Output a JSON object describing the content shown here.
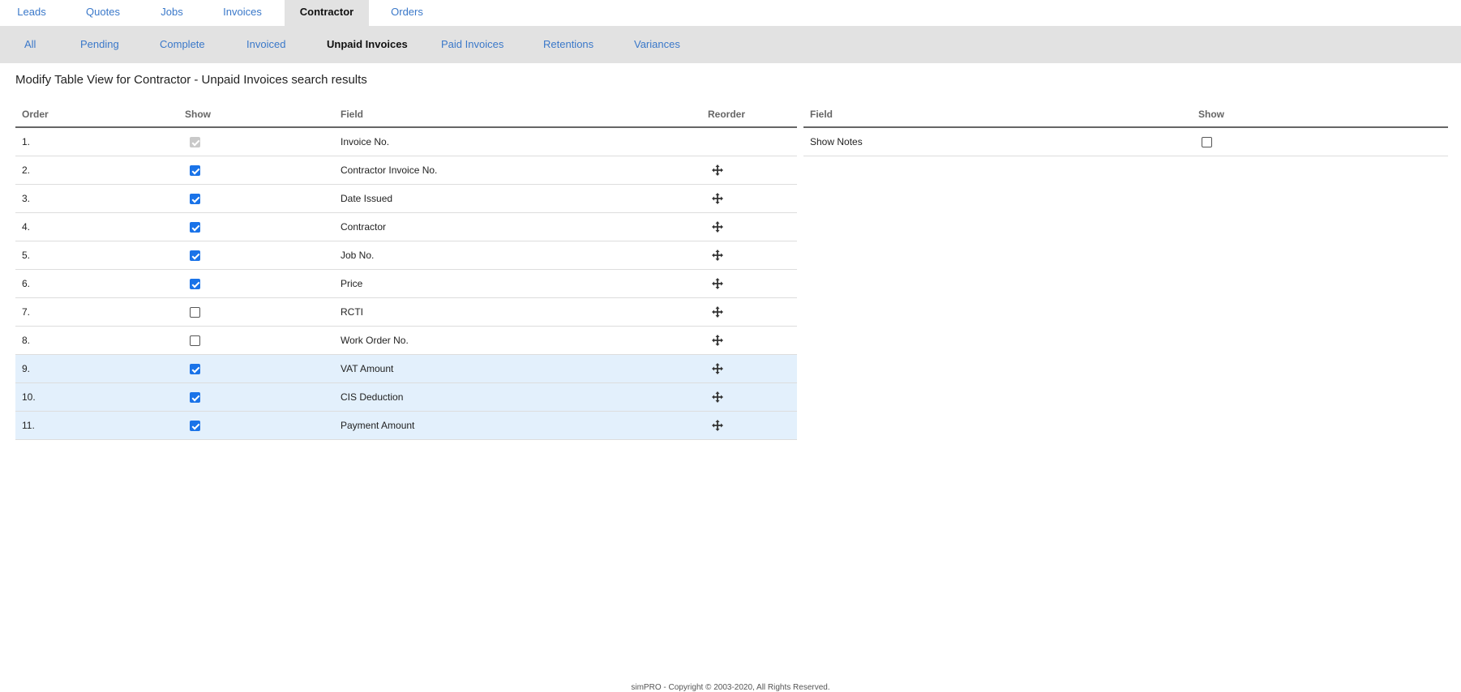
{
  "top_tabs": [
    {
      "label": "Leads",
      "active": false
    },
    {
      "label": "Quotes",
      "active": false
    },
    {
      "label": "Jobs",
      "active": false
    },
    {
      "label": "Invoices",
      "active": false
    },
    {
      "label": "Contractor",
      "active": true
    },
    {
      "label": "Orders",
      "active": false
    }
  ],
  "sub_tabs": [
    {
      "label": "All",
      "active": false
    },
    {
      "label": "Pending",
      "active": false
    },
    {
      "label": "Complete",
      "active": false
    },
    {
      "label": "Invoiced",
      "active": false
    },
    {
      "label": "Unpaid Invoices",
      "active": true
    },
    {
      "label": "Paid Invoices",
      "active": false
    },
    {
      "label": "Retentions",
      "active": false
    },
    {
      "label": "Variances",
      "active": false
    }
  ],
  "page_title": "Modify Table View for Contractor - Unpaid Invoices search results",
  "main_table": {
    "headers": {
      "order": "Order",
      "show": "Show",
      "field": "Field",
      "reorder": "Reorder"
    },
    "rows": [
      {
        "order": "1.",
        "show": "disabled-checked",
        "field": "Invoice No.",
        "reorder": false,
        "highlight": false
      },
      {
        "order": "2.",
        "show": "checked",
        "field": "Contractor Invoice No.",
        "reorder": true,
        "highlight": false
      },
      {
        "order": "3.",
        "show": "checked",
        "field": "Date Issued",
        "reorder": true,
        "highlight": false
      },
      {
        "order": "4.",
        "show": "checked",
        "field": "Contractor",
        "reorder": true,
        "highlight": false
      },
      {
        "order": "5.",
        "show": "checked",
        "field": "Job No.",
        "reorder": true,
        "highlight": false
      },
      {
        "order": "6.",
        "show": "checked",
        "field": "Price",
        "reorder": true,
        "highlight": false
      },
      {
        "order": "7.",
        "show": "unchecked",
        "field": "RCTI",
        "reorder": true,
        "highlight": false
      },
      {
        "order": "8.",
        "show": "unchecked",
        "field": "Work Order No.",
        "reorder": true,
        "highlight": false
      },
      {
        "order": "9.",
        "show": "checked",
        "field": "VAT Amount",
        "reorder": true,
        "highlight": true
      },
      {
        "order": "10.",
        "show": "checked",
        "field": "CIS Deduction",
        "reorder": true,
        "highlight": true
      },
      {
        "order": "11.",
        "show": "checked",
        "field": "Payment Amount",
        "reorder": true,
        "highlight": true
      }
    ]
  },
  "side_table": {
    "headers": {
      "field": "Field",
      "show": "Show"
    },
    "rows": [
      {
        "field": "Show Notes",
        "show": "unchecked"
      }
    ]
  },
  "footer": "simPRO - Copyright © 2003-2020, All Rights Reserved.",
  "icons": {
    "reorder": "move-icon"
  },
  "colors": {
    "link": "#3a78c9",
    "tab_bar": "#e2e2e2",
    "checkbox": "#1a73e8",
    "highlight_row": "#e3f0fc"
  }
}
